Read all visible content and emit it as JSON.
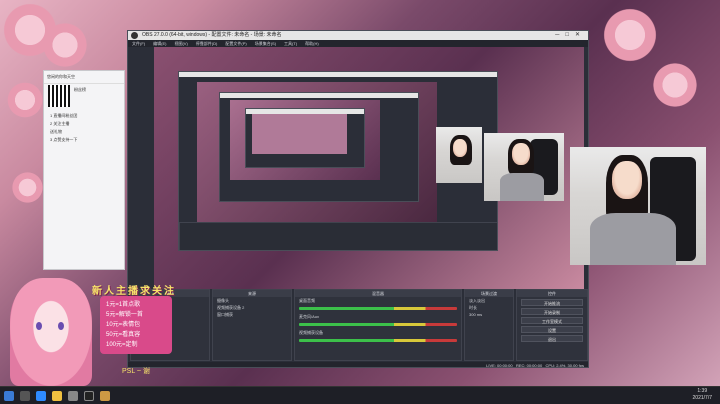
{
  "window": {
    "title": "OBS 27.0.0 (64-bit, windows) - 配置文件: 未命名 - 场景: 未命名"
  },
  "menu": [
    "文件(F)",
    "编辑(E)",
    "视图(V)",
    "停靠部件(D)",
    "配置文件(P)",
    "场景集合(S)",
    "工具(T)",
    "帮助(H)"
  ],
  "docks": {
    "scenes": {
      "title": "场景"
    },
    "sources": {
      "title": "来源",
      "items": [
        "摄像头",
        "视频捕获设备 2",
        "窗口捕获"
      ]
    },
    "mixer": {
      "title": "混音器",
      "channels": [
        "桌面音频",
        "麦克风/Aux",
        "视频捕获设备"
      ]
    },
    "transitions": {
      "title": "场景过渡",
      "type": "淡入淡出",
      "duration_label": "时长",
      "duration": "300 ms"
    },
    "controls": {
      "title": "控件",
      "buttons": [
        "开始推流",
        "开始录制",
        "工作室模式",
        "设置",
        "退出"
      ]
    }
  },
  "status": {
    "live": "LIVE: 00:00:00",
    "rec": "REC: 00:00:00",
    "cpu": "CPU: 2.4%, 30.00 fps"
  },
  "chat": {
    "title": "悠闲的你和天空",
    "rank": "粉丝榜",
    "items": [
      "1 直播间粉丝团",
      "2 关注主播",
      "送礼物",
      "3 点赞支持一下"
    ]
  },
  "overlay": {
    "title": "新人主播求关注",
    "lines": [
      "1元=1首点歌",
      "5元=解锁一首",
      "10元=表情包",
      "50元=看真容",
      "100元=定制"
    ],
    "footer": "PSL ~ 谢"
  },
  "taskbar": {
    "time": "1:39",
    "date": "2021/7/7"
  },
  "colors": {
    "accent": "#d94a8a",
    "obs_bg": "#2b2e38",
    "meter_green": "#3cc04a"
  }
}
